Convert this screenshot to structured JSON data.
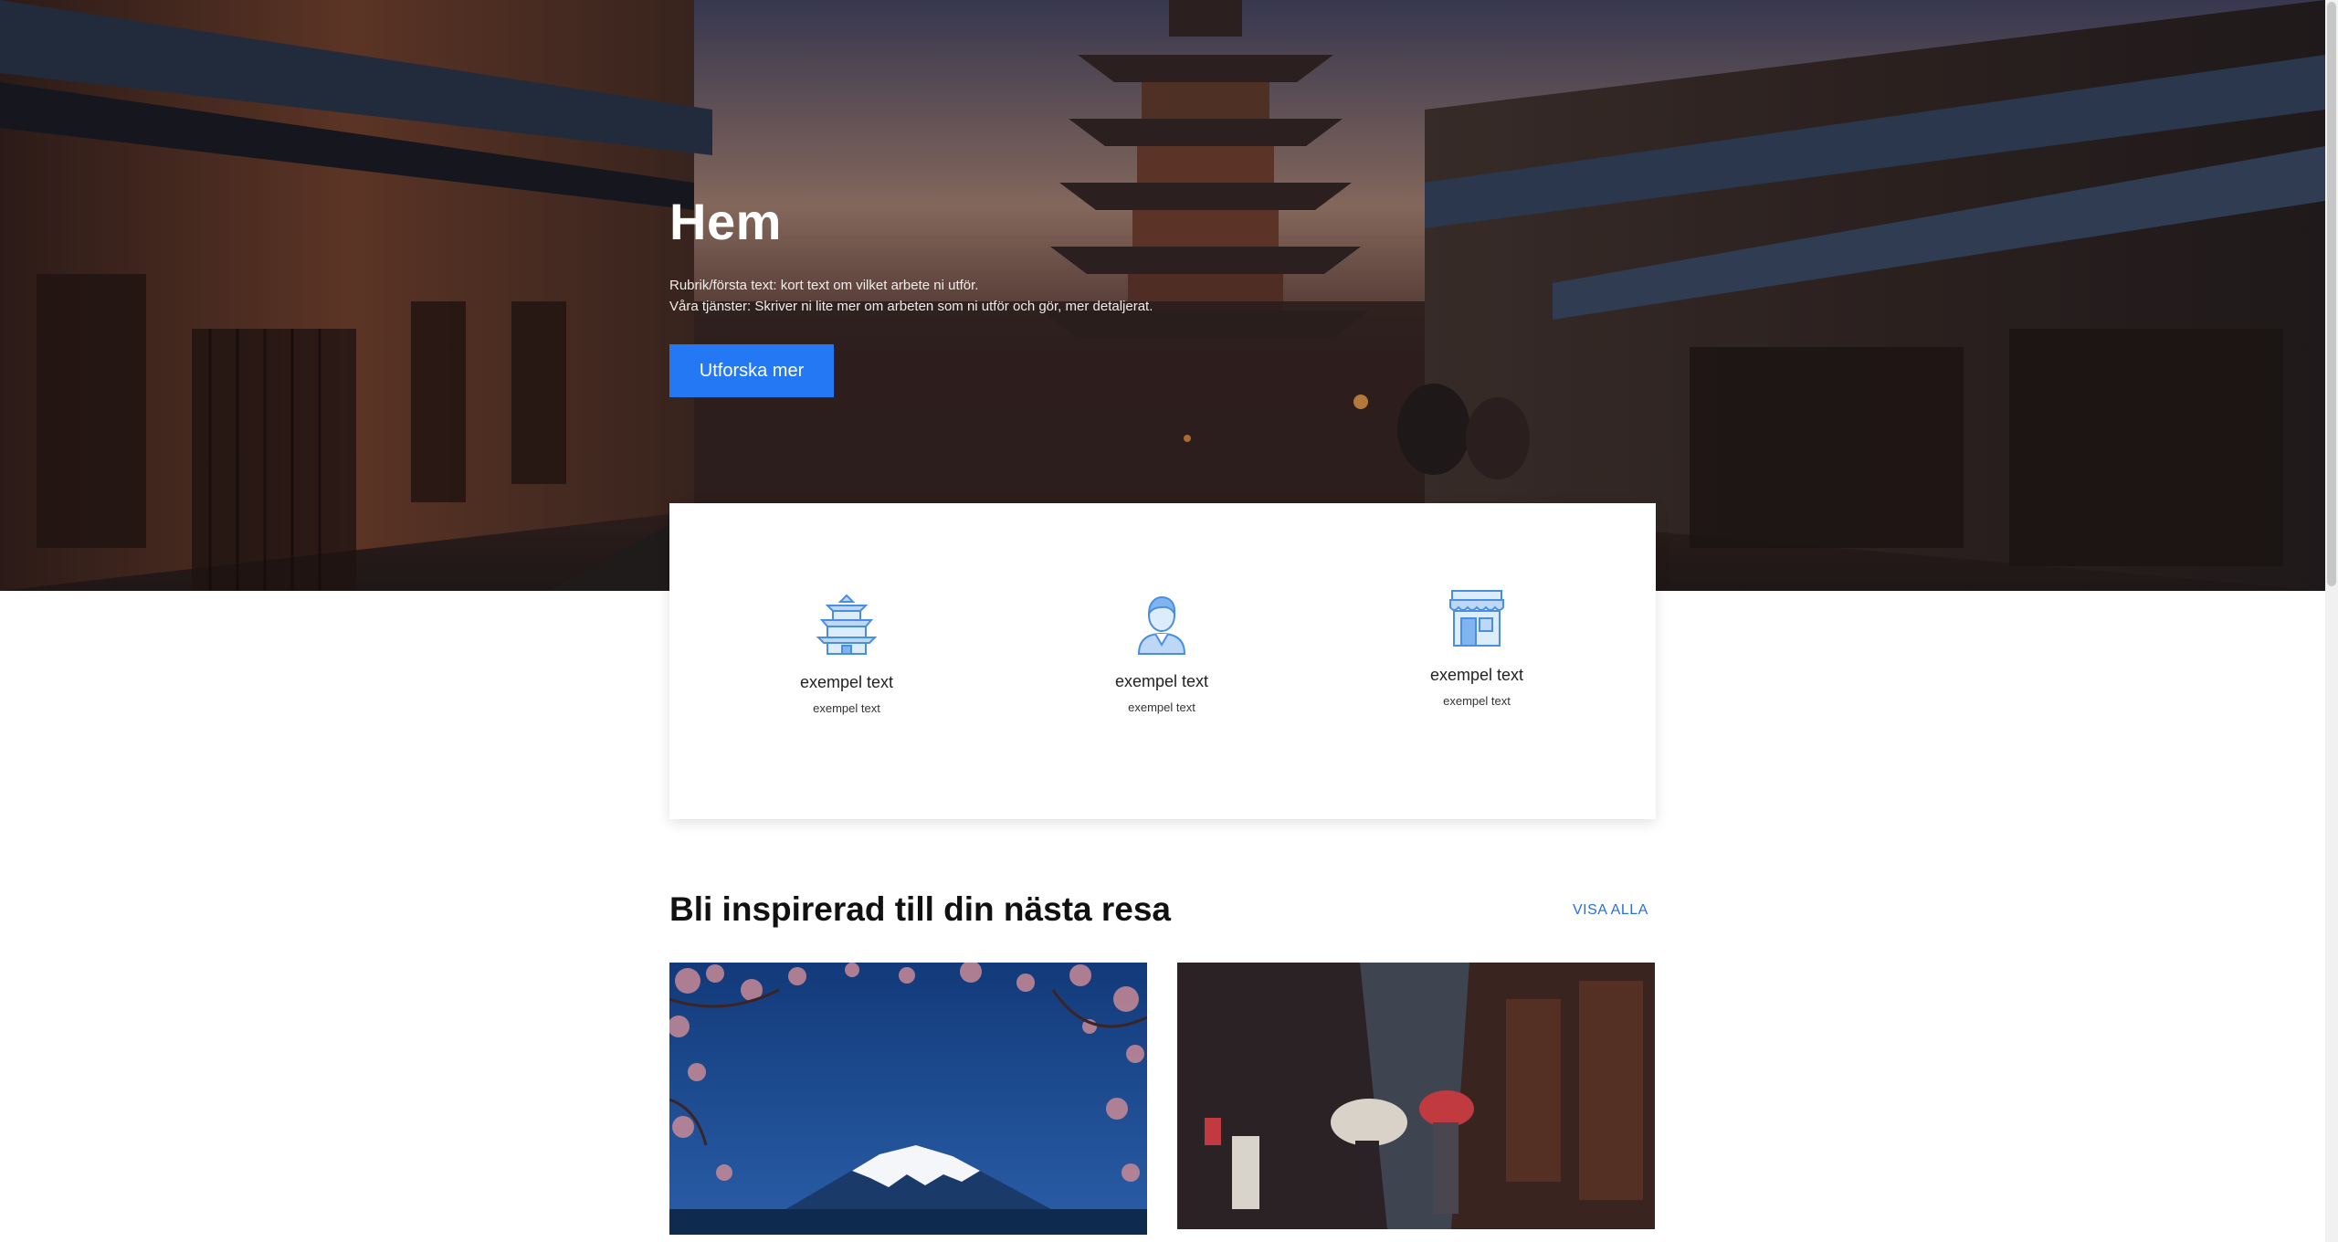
{
  "hero": {
    "title": "Hem",
    "line1": "Rubrik/första text: kort text om vilket arbete ni utför.",
    "line2": "Våra tjänster: Skriver ni lite mer om arbeten som ni utför och gör, mer detaljerat.",
    "button_label": "Utforska mer"
  },
  "features": [
    {
      "icon": "pagoda-icon",
      "title": "exempel text",
      "subtitle": "exempel text"
    },
    {
      "icon": "person-icon",
      "title": "exempel text",
      "subtitle": "exempel text"
    },
    {
      "icon": "shop-icon",
      "title": "exempel text",
      "subtitle": "exempel text"
    }
  ],
  "inspiration": {
    "title": "Bli inspirerad till din nästa resa",
    "view_all": "VISA ALLA"
  },
  "colors": {
    "accent": "#2478f4",
    "link": "#2a6fd8",
    "icon": "#5aa2f0"
  }
}
